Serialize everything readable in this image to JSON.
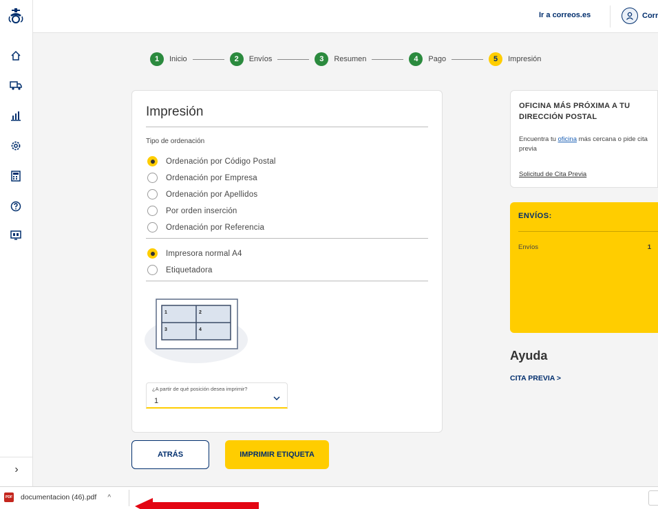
{
  "header": {
    "link": "Ir a correos.es",
    "user_name": "Correos"
  },
  "sidebar": {
    "items": [
      {
        "icon": "home-icon"
      },
      {
        "icon": "truck-icon"
      },
      {
        "icon": "bar-chart-icon"
      },
      {
        "icon": "gear-icon"
      },
      {
        "icon": "calculator-icon"
      },
      {
        "icon": "help-icon"
      },
      {
        "icon": "monitor-icon"
      }
    ],
    "expand_glyph": "›"
  },
  "stepper": {
    "steps": [
      {
        "num": "1",
        "label": "Inicio"
      },
      {
        "num": "2",
        "label": "Envíos"
      },
      {
        "num": "3",
        "label": "Resumen"
      },
      {
        "num": "4",
        "label": "Pago"
      },
      {
        "num": "5",
        "label": "Impresión"
      }
    ]
  },
  "main": {
    "title": "Impresión",
    "ordering_label": "Tipo de ordenación",
    "ordering_options": [
      {
        "label": "Ordenación por Código Postal",
        "checked": true
      },
      {
        "label": "Ordenación por Empresa",
        "checked": false
      },
      {
        "label": "Ordenación por Apellidos",
        "checked": false
      },
      {
        "label": "Por orden inserción",
        "checked": false
      },
      {
        "label": "Ordenación por Referencia",
        "checked": false
      }
    ],
    "printer_options": [
      {
        "label": "Impresora normal A4",
        "checked": true
      },
      {
        "label": "Etiquetadora",
        "checked": false
      }
    ],
    "grid_cells": [
      "1",
      "2",
      "3",
      "4"
    ],
    "position_select": {
      "label": "¿A partir de qué posición desea imprimir?",
      "value": "1"
    }
  },
  "buttons": {
    "back": "ATRÁS",
    "print": "IMPRIMIR ETIQUETA"
  },
  "office": {
    "title": "OFICINA MÁS PRÓXIMA A TU DIRECCIÓN POSTAL",
    "text_before": "Encuentra tu ",
    "text_link": "oficina",
    "text_after": " más cercana o pide cita previa",
    "link": "Solicitud de Cita Previa"
  },
  "envios": {
    "title": "ENVÍOS:",
    "row_label": "Envíos",
    "row_value": "1"
  },
  "help": {
    "title": "Ayuda",
    "link": "CITA PREVIA >"
  },
  "download": {
    "file_name": "documentacion (46).pdf",
    "caret": "^",
    "pdf_badge": "PDF"
  },
  "colors": {
    "accent": "#ffcd00",
    "navy": "#002e6d",
    "step_done": "#2b8a3e",
    "arrow": "#e30613"
  }
}
